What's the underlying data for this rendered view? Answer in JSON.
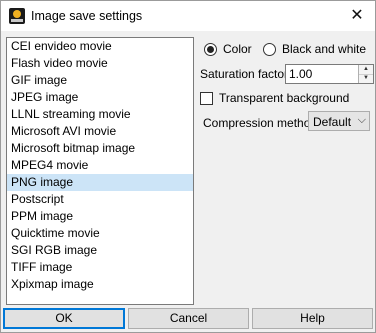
{
  "window": {
    "title": "Image save settings"
  },
  "formats": [
    "CEI envideo movie",
    "Flash video movie",
    "GIF image",
    "JPEG image",
    "LLNL streaming movie",
    "Microsoft AVI movie",
    "Microsoft bitmap image",
    "MPEG4 movie",
    "PNG image",
    "Postscript",
    "PPM image",
    "Quicktime movie",
    "SGI RGB image",
    "TIFF image",
    "Xpixmap image"
  ],
  "selected_format": "PNG image",
  "color_mode": {
    "color_label": "Color",
    "bw_label": "Black and white",
    "selected": "Color"
  },
  "saturation": {
    "label": "Saturation factor",
    "value": "1.00"
  },
  "transparent": {
    "label": "Transparent background",
    "checked": false
  },
  "compression": {
    "label": "Compression method",
    "value": "Default"
  },
  "buttons": {
    "ok": "OK",
    "cancel": "Cancel",
    "help": "Help"
  },
  "icons": {
    "app": "app-icon",
    "close": "close-icon"
  },
  "colors": {
    "selection": "#cce4f7",
    "accent": "#0078d7"
  }
}
